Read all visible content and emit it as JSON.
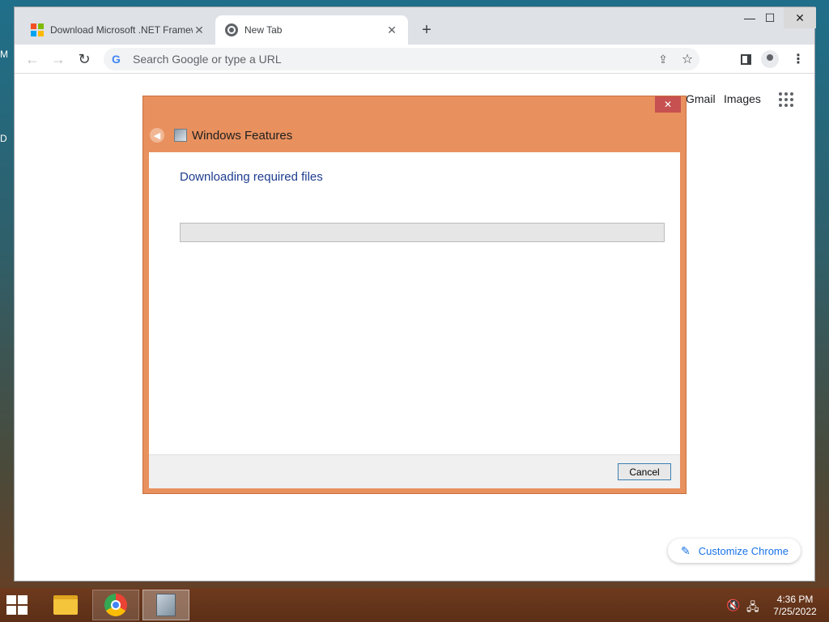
{
  "desktop": {
    "letter_1": "M",
    "letter_2": "D"
  },
  "chrome": {
    "tabs": [
      {
        "title": "Download Microsoft .NET Framework",
        "close": "✕",
        "icon": "microsoft-logo-icon"
      },
      {
        "title": "New Tab",
        "close": "✕",
        "icon": "chrome-icon"
      }
    ],
    "new_tab": "+",
    "window_controls": {
      "minimize": "—",
      "maximize": "☐",
      "close": "✕"
    },
    "toolbar": {
      "back": "←",
      "forward": "→",
      "reload": "↻",
      "menu": "⋮",
      "share": "⇪",
      "bookmark": "☆"
    },
    "omnibox": {
      "g_icon": "G",
      "placeholder": "Search Google or type a URL"
    },
    "ntp": {
      "gmail": "Gmail",
      "images": "Images",
      "customize": "Customize Chrome",
      "pencil": "✎"
    }
  },
  "dialog": {
    "title": "Windows Features",
    "close": "✕",
    "back": "◀",
    "heading": "Downloading required files",
    "progress_fraction": 0,
    "cancel": "Cancel",
    "colors": {
      "frame": "#e8915f",
      "close": "#c75050",
      "heading": "#1e3d8f"
    }
  },
  "taskbar": {
    "apps": [
      "file-explorer-icon",
      "chrome-icon",
      "windows-features-icon"
    ],
    "volume": "🔇",
    "network": "🖧",
    "time": "4:36 PM",
    "date": "7/25/2022"
  }
}
